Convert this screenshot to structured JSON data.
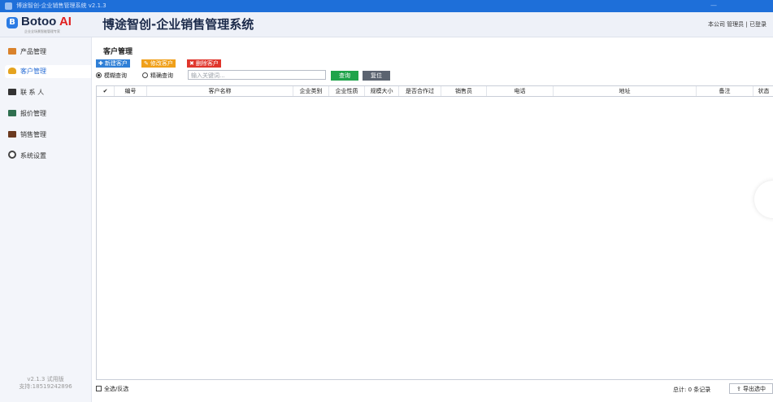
{
  "window": {
    "title": "博途智创-企业销售管理系统 v2.1.3"
  },
  "header": {
    "logo_mark": "B",
    "logo_name": "Botoo ",
    "logo_ai": "AI",
    "logo_sub": "企业全场景智能管理专家",
    "app_title": "博途智创-企业销售管理系统",
    "user_info": "本公司  管理员 | 已登录"
  },
  "sidebar": {
    "items": [
      {
        "label": "产品管理",
        "icon": "product-icon",
        "color": "#d9822b"
      },
      {
        "label": "客户管理",
        "icon": "customer-icon",
        "color": "#e5a31f"
      },
      {
        "label": "联 系 人",
        "icon": "contacts-icon",
        "color": "#333333"
      },
      {
        "label": "报价管理",
        "icon": "quote-icon",
        "color": "#2f6f4f"
      },
      {
        "label": "销售管理",
        "icon": "sales-icon",
        "color": "#6b3a1f"
      },
      {
        "label": "系统设置",
        "icon": "settings-icon",
        "color": "#444444"
      }
    ],
    "active_index": 1,
    "footer_version": "v2.1.3  试用版",
    "footer_support": "支持:18519242896"
  },
  "main": {
    "page_title": "客户管理",
    "toolbar": [
      {
        "label": "新建客户",
        "color": "#2f7fd6",
        "icon": "add-icon"
      },
      {
        "label": "修改客户",
        "color": "#f0a01a",
        "icon": "edit-icon"
      },
      {
        "label": "删除客户",
        "color": "#e0362c",
        "icon": "delete-icon"
      }
    ],
    "search": {
      "mode_fuzzy": "模糊查询",
      "mode_exact": "精确查询",
      "selected_mode": "模糊查询",
      "placeholder": "输入关键词...",
      "query_label": "查询",
      "reset_label": "复位"
    },
    "table": {
      "columns": [
        "✔",
        "编号",
        "客户名称",
        "企业类别",
        "企业性质",
        "规模大小",
        "是否合作过",
        "销售员",
        "电话",
        "地址",
        "备注",
        "状态"
      ],
      "rows": []
    },
    "footer": {
      "select_all": "全选/反选",
      "total": "总计: 0 条记录",
      "export": "导出选中"
    }
  }
}
